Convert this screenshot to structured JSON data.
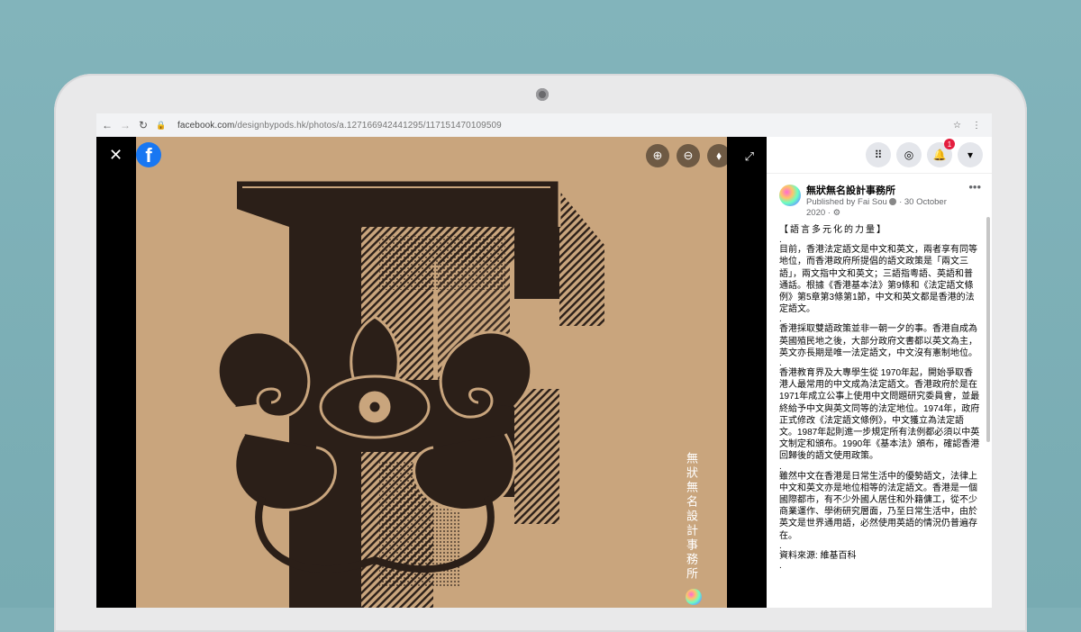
{
  "browser": {
    "url_domain": "facebook.com",
    "url_path": "/designbypods.hk/photos/a.127166942441295/117151470109509"
  },
  "viewer": {
    "close_icon": "close-icon",
    "tools": [
      "zoom-in-icon",
      "zoom-out-icon",
      "tag-icon"
    ],
    "expand_icon": "expand-icon",
    "watermark_text": "無狀無名設計事務所"
  },
  "topbar": {
    "icons": [
      "menu-grid-icon",
      "messenger-icon",
      "notifications-icon",
      "account-menu-icon"
    ],
    "notification_count": "1"
  },
  "post": {
    "author": "無狀無名設計事務所",
    "published_by": "Published by Fai Sou",
    "date": "· 30 October 2020 ·",
    "heading": "【語言多元化的力量】",
    "paragraphs": [
      ".",
      "目前，香港法定語文是中文和英文，兩者享有同等地位，而香港政府所提倡的語文政策是「兩文三語」，兩文指中文和英文；三語指粵語、英語和普通話。根據《香港基本法》第9條和《法定語文條例》第5章第3條第1節，中文和英文都是香港的法定語文。",
      ".",
      "香港採取雙語政策並非一朝一夕的事。香港自成為英國殖民地之後，大部分政府文書都以英文為主，英文亦長期是唯一法定語文，中文沒有憲制地位。",
      ".",
      "香港教育界及大專學生從 1970年起，開始爭取香港人最常用的中文成為法定語文。香港政府於是在 1971年成立公事上使用中文問題研究委員會，並最終給予中文與英文同等的法定地位。1974年，政府正式修改《法定語文條例》，中文獲立為法定語文。1987年起則進一步規定所有法例都必須以中英文制定和頒布。1990年《基本法》頒布，確認香港回歸後的語文使用政策。",
      ".",
      "雖然中文在香港是日常生活中的優勢語文，法律上中文和英文亦是地位相等的法定語文。香港是一個國際都市，有不少外國人居住和外籍傭工，從不少商業運作、學術研究層面，乃至日常生活中，由於英文是世界通用語，必然使用英語的情況仍普遍存在。",
      ".",
      "資料來源: 維基百科",
      "."
    ]
  },
  "colors": {
    "background": "#7fb0b7",
    "facebook_blue": "#1877f2",
    "badge_red": "#e41e3f",
    "photo_paper": "#c9a57d",
    "ink": "#2b1f18"
  }
}
